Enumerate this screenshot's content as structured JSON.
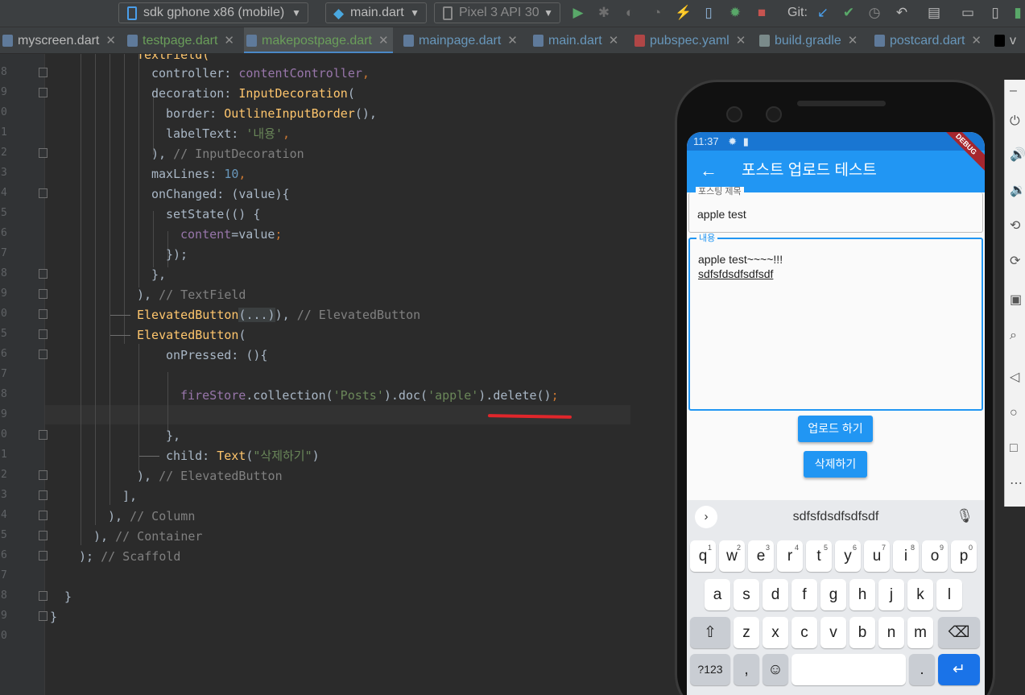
{
  "toolbar": {
    "device_selector": "sdk gphone x86 (mobile)",
    "run_config": "main.dart",
    "avd_selector": "Pixel 3 API 30",
    "git_label": "Git:"
  },
  "tabs": [
    {
      "label": "myscreen.dart",
      "color": "#bbbbbb"
    },
    {
      "label": "testpage.dart",
      "color": "#6a9e5a"
    },
    {
      "label": "makepostpage.dart",
      "color": "#6a9e5a"
    },
    {
      "label": "mainpage.dart",
      "color": "#6897bb"
    },
    {
      "label": "main.dart",
      "color": "#6897bb"
    },
    {
      "label": "pubspec.yaml",
      "color": "#6897bb"
    },
    {
      "label": "build.gradle",
      "color": "#6897bb"
    },
    {
      "label": "postcard.dart",
      "color": "#6897bb"
    },
    {
      "label": "v",
      "color": "#bbbbbb"
    }
  ],
  "editor": {
    "line_numbers": [
      "8",
      "9",
      "0",
      "1",
      "2",
      "3",
      "4",
      "5",
      "6",
      "7",
      "8",
      "9",
      "0",
      "5",
      "6",
      "7",
      "8",
      "9",
      "0",
      "1",
      "2",
      "3",
      "4",
      "5",
      "6",
      "7",
      "8",
      "9",
      "0"
    ],
    "code": {
      "l0": "TextField(",
      "l1a": "controller: ",
      "l1b": "contentController",
      "l1c": ",",
      "l2a": "decoration: ",
      "l2b": "InputDecoration",
      "l2c": "(",
      "l3a": "border: ",
      "l3b": "OutlineInputBorder",
      "l3c": "(),",
      "l4a": "labelText: ",
      "l4b": "'내용'",
      "l4c": ",",
      "l5a": "), ",
      "l5b": "// InputDecoration",
      "l6a": "maxLines: ",
      "l6b": "10",
      "l6c": ",",
      "l7a": "onChanged: (value){",
      "l8a": "setState(() {",
      "l9a": "content",
      "l9b": "=value",
      "l9c": ";",
      "l10a": "});",
      "l11a": "},",
      "l12a": "), ",
      "l12b": "// TextField",
      "l13a": "ElevatedButton",
      "l13b": "(...)",
      "l13c": "), ",
      "l13d": "// ElevatedButton",
      "l14a": "ElevatedButton",
      "l14b": "(",
      "l15a": "onPressed: (){",
      "l17a": "fireStore",
      "l17b": ".collection(",
      "l17c": "'Posts'",
      "l17d": ").doc(",
      "l17e": "'apple'",
      "l17f": ").delete()",
      "l17g": ";",
      "l19a": "},",
      "l20a": "child: ",
      "l20b": "Text",
      "l20c": "(",
      "l20d": "\"삭제하기\"",
      "l20e": ")",
      "l21a": "), ",
      "l21b": "// ElevatedButton",
      "l22a": "],",
      "l23a": "), ",
      "l23b": "// Column",
      "l24a": "), ",
      "l24b": "// Container",
      "l25a": "); ",
      "l25b": "// Scaffold",
      "l27a": "}",
      "l28a": "}"
    }
  },
  "phone": {
    "status_time": "11:37",
    "appbar_title": "포스트 업로드 테스트",
    "debug_banner": "DEBUG",
    "title_field": {
      "label": "포스팅 제목",
      "value": "apple test"
    },
    "content_field": {
      "label": "내용",
      "line1": "apple test~~~~!!!",
      "line2": "sdfsfdsdfsdfsdf"
    },
    "upload_button": "업로드 하기",
    "delete_button": "삭제하기",
    "keyboard": {
      "suggestion": "sdfsfdsdfsdfsdf",
      "row1": [
        "q",
        "w",
        "e",
        "r",
        "t",
        "y",
        "u",
        "i",
        "o",
        "p"
      ],
      "row1_hints": [
        "1",
        "2",
        "3",
        "4",
        "5",
        "6",
        "7",
        "8",
        "9",
        "0"
      ],
      "row2": [
        "a",
        "s",
        "d",
        "f",
        "g",
        "h",
        "j",
        "k",
        "l"
      ],
      "row3": [
        "z",
        "x",
        "c",
        "v",
        "b",
        "n",
        "m"
      ],
      "sym_key": "?123",
      "comma_key": ",",
      "period_key": "."
    }
  },
  "colors": {
    "accent": "#2196f3",
    "underline": "#e0262b"
  }
}
